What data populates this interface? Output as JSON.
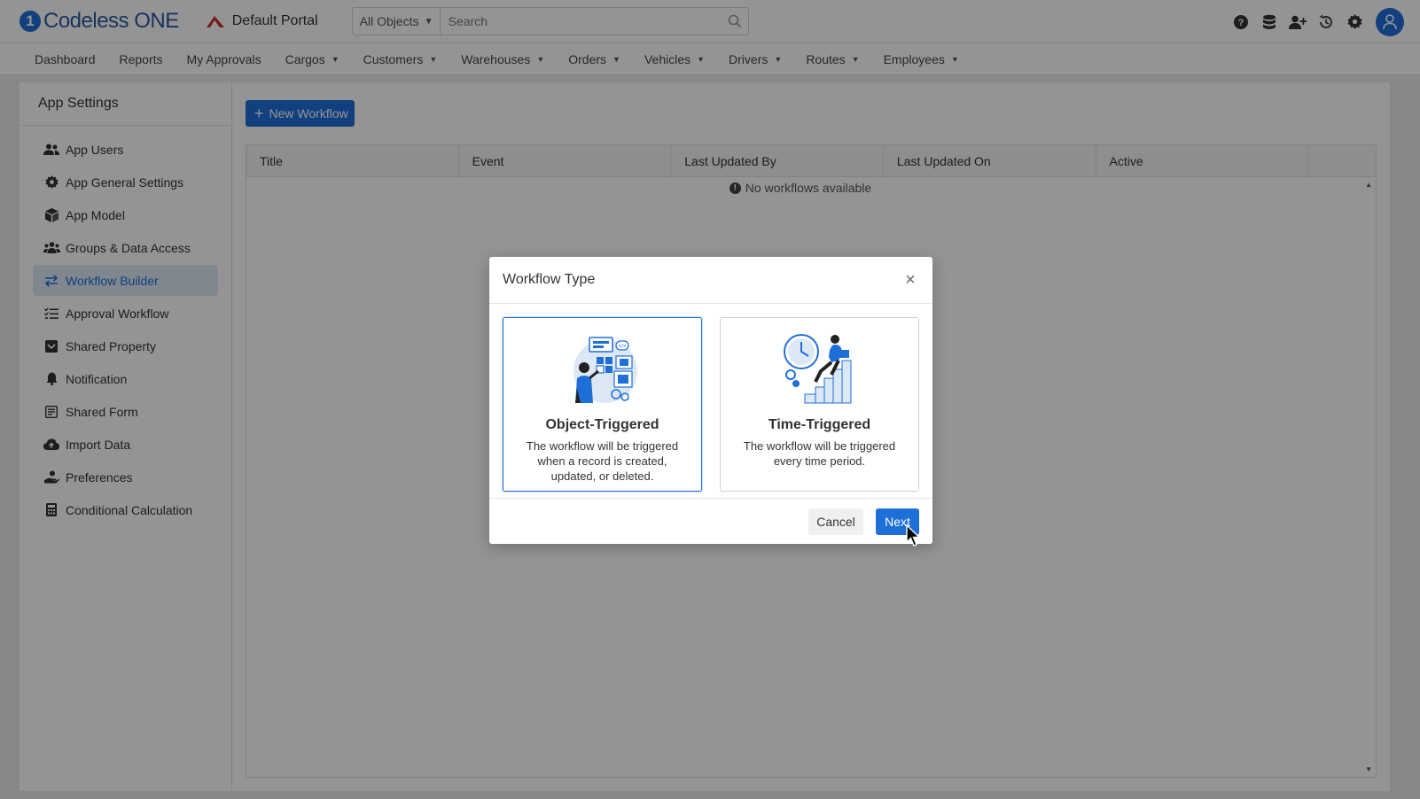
{
  "header": {
    "logo_text": "Codeless ONE",
    "portal_name": "Default Portal",
    "search_scope": "All Objects",
    "search_placeholder": "Search"
  },
  "nav": {
    "items": [
      {
        "label": "Dashboard",
        "dropdown": false
      },
      {
        "label": "Reports",
        "dropdown": false
      },
      {
        "label": "My Approvals",
        "dropdown": false
      },
      {
        "label": "Cargos",
        "dropdown": true
      },
      {
        "label": "Customers",
        "dropdown": true
      },
      {
        "label": "Warehouses",
        "dropdown": true
      },
      {
        "label": "Orders",
        "dropdown": true
      },
      {
        "label": "Vehicles",
        "dropdown": true
      },
      {
        "label": "Drivers",
        "dropdown": true
      },
      {
        "label": "Routes",
        "dropdown": true
      },
      {
        "label": "Employees",
        "dropdown": true
      }
    ]
  },
  "sidebar": {
    "title": "App Settings",
    "items": [
      {
        "label": "App Users",
        "icon": "users-icon"
      },
      {
        "label": "App General Settings",
        "icon": "gear-icon"
      },
      {
        "label": "App Model",
        "icon": "cube-icon"
      },
      {
        "label": "Groups & Data Access",
        "icon": "group-icon"
      },
      {
        "label": "Workflow Builder",
        "icon": "swap-arrows-icon",
        "active": true
      },
      {
        "label": "Approval Workflow",
        "icon": "checklist-icon"
      },
      {
        "label": "Shared Property",
        "icon": "inbox-icon"
      },
      {
        "label": "Notification",
        "icon": "bell-icon"
      },
      {
        "label": "Shared Form",
        "icon": "form-icon"
      },
      {
        "label": "Import Data",
        "icon": "cloud-upload-icon"
      },
      {
        "label": "Preferences",
        "icon": "user-hand-icon"
      },
      {
        "label": "Conditional Calculation",
        "icon": "calculator-icon"
      }
    ]
  },
  "main": {
    "new_button_label": "New Workflow",
    "columns": [
      "Title",
      "Event",
      "Last Updated By",
      "Last Updated On",
      "Active"
    ],
    "empty_message": "No workflows available"
  },
  "modal": {
    "title": "Workflow Type",
    "options": [
      {
        "title": "Object-Triggered",
        "description": "The workflow will be triggered when a record is created, updated, or deleted.",
        "selected": true
      },
      {
        "title": "Time-Triggered",
        "description": "The workflow will be triggered every time period.",
        "selected": false
      }
    ],
    "cancel_label": "Cancel",
    "next_label": "Next"
  },
  "colors": {
    "primary": "#1f6fd9",
    "active_bg": "#dde8f6",
    "overlay": "rgba(0,0,0,0.42)"
  }
}
